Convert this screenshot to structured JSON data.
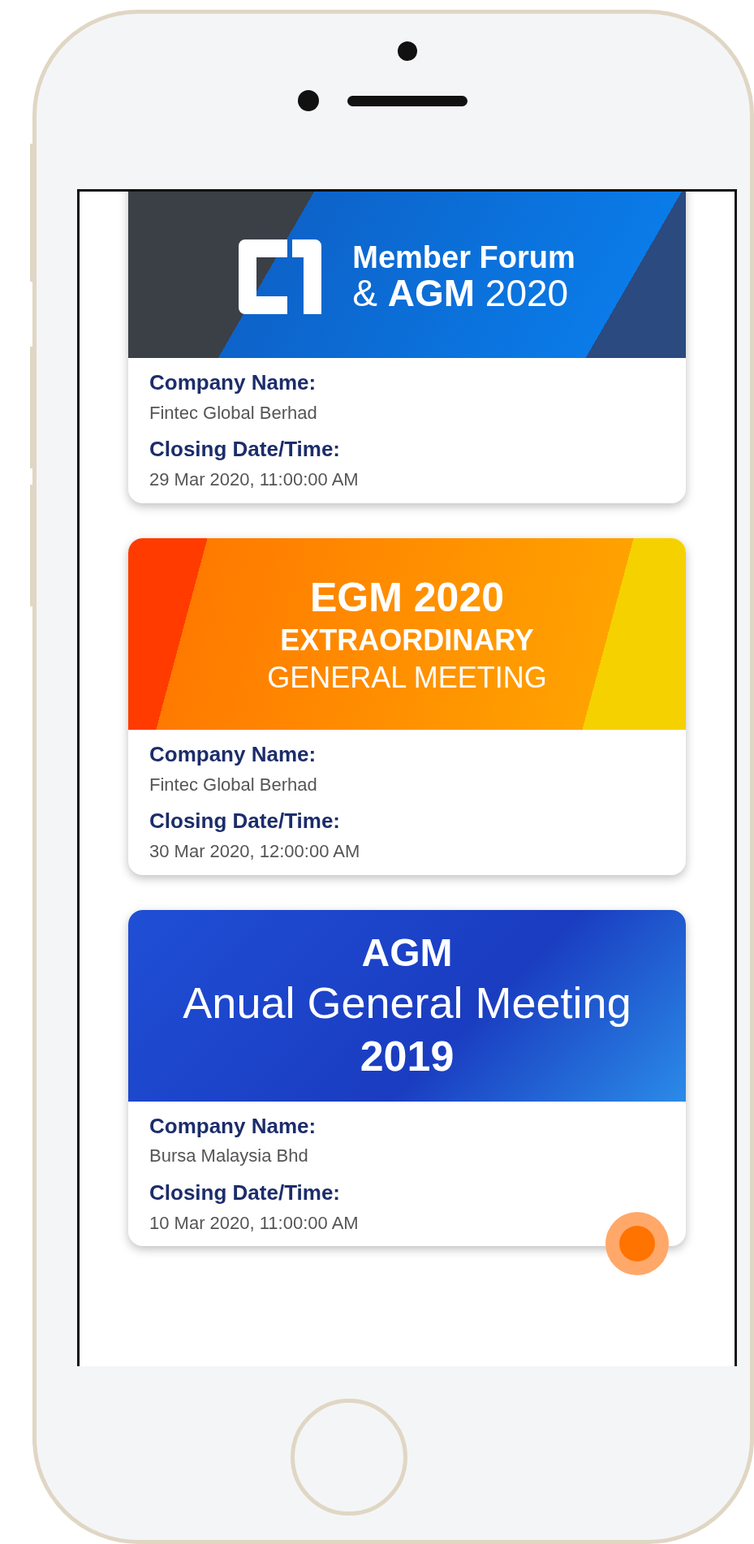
{
  "events": [
    {
      "banner": {
        "kind": "forum",
        "lines": [
          "Member Forum",
          "& **AGM** 2020"
        ]
      },
      "fields": [
        {
          "label": "Company Name:",
          "value": "Fintec Global Berhad"
        },
        {
          "label": "Closing Date/Time:",
          "value": "29 Mar 2020, 11:00:00 AM"
        }
      ]
    },
    {
      "banner": {
        "kind": "egm",
        "lines": [
          "EGM 2020",
          "EXTRAORDINARY",
          "GENERAL MEETING"
        ]
      },
      "fields": [
        {
          "label": "Company Name:",
          "value": "Fintec Global Berhad"
        },
        {
          "label": "Closing Date/Time:",
          "value": "30 Mar 2020, 12:00:00 AM"
        }
      ]
    },
    {
      "banner": {
        "kind": "agm",
        "lines": [
          "AGM",
          "Anual General Meeting",
          "2019"
        ]
      },
      "fields": [
        {
          "label": "Company Name:",
          "value": "Bursa Malaysia Bhd"
        },
        {
          "label": "Closing Date/Time:",
          "value": "10 Mar 2020, 11:00:00 AM"
        }
      ]
    }
  ]
}
